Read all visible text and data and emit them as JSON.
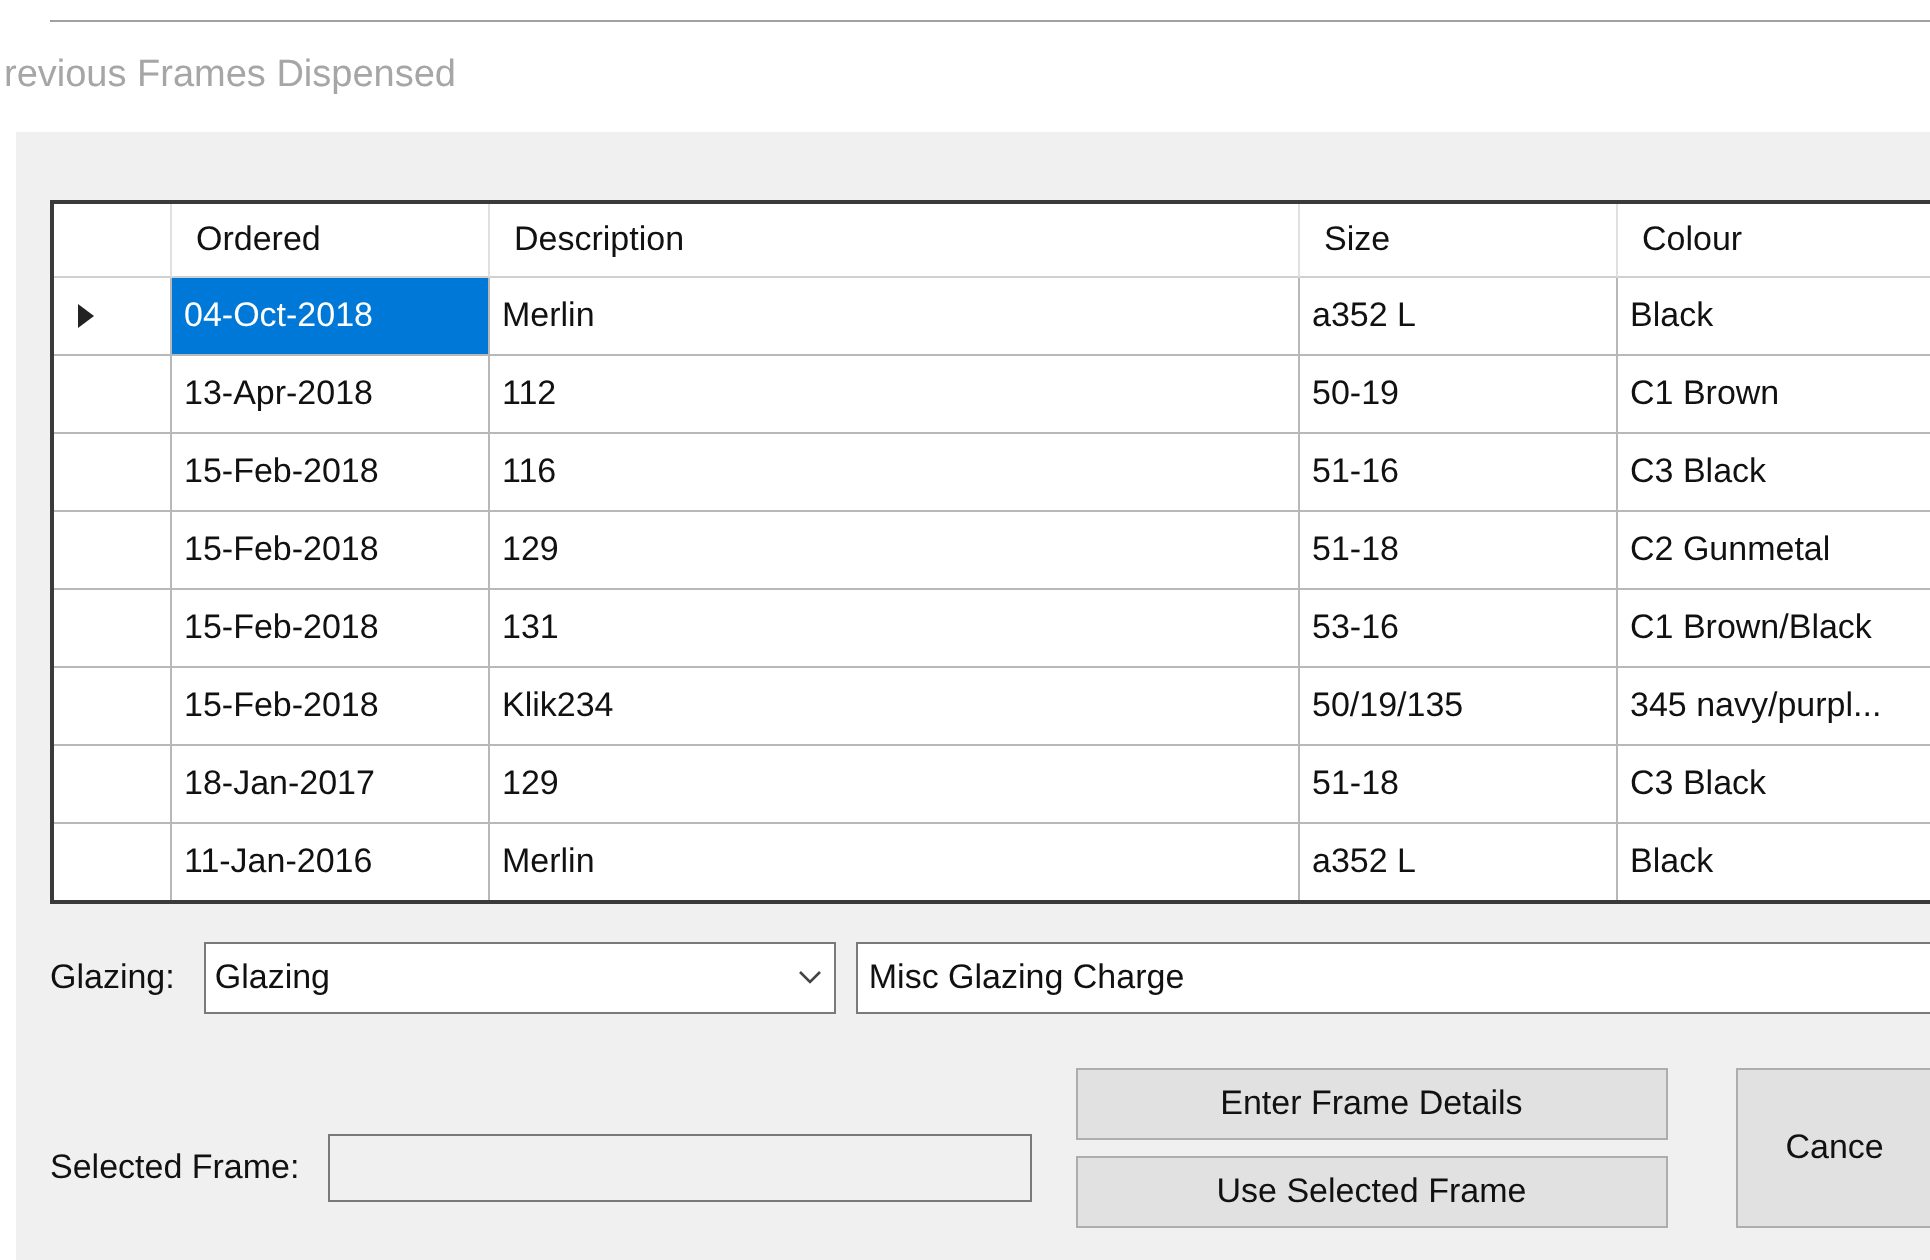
{
  "heading": "revious Frames Dispensed",
  "table": {
    "columns": [
      "Ordered",
      "Description",
      "Size",
      "Colour"
    ],
    "rows": [
      {
        "selected": true,
        "cells": [
          "04-Oct-2018",
          "Merlin",
          "a352 L",
          "Black"
        ]
      },
      {
        "selected": false,
        "cells": [
          "13-Apr-2018",
          "112",
          "50-19",
          "C1 Brown"
        ]
      },
      {
        "selected": false,
        "cells": [
          "15-Feb-2018",
          "116",
          "51-16",
          "C3 Black"
        ]
      },
      {
        "selected": false,
        "cells": [
          "15-Feb-2018",
          "129",
          "51-18",
          "C2 Gunmetal"
        ]
      },
      {
        "selected": false,
        "cells": [
          "15-Feb-2018",
          "131",
          "53-16",
          "C1 Brown/Black"
        ]
      },
      {
        "selected": false,
        "cells": [
          "15-Feb-2018",
          "Klik234",
          "50/19/135",
          "345 navy/purpl..."
        ]
      },
      {
        "selected": false,
        "cells": [
          "18-Jan-2017",
          "129",
          "51-18",
          "C3 Black"
        ]
      },
      {
        "selected": false,
        "cells": [
          "11-Jan-2016",
          "Merlin",
          "a352 L",
          "Black"
        ]
      }
    ]
  },
  "glazing": {
    "label": "Glazing:",
    "value": "Glazing",
    "charge": "Misc Glazing Charge"
  },
  "selected_frame": {
    "label": "Selected Frame:"
  },
  "buttons": {
    "enter": "Enter Frame Details",
    "use": "Use Selected Frame",
    "cancel": "Cance"
  }
}
